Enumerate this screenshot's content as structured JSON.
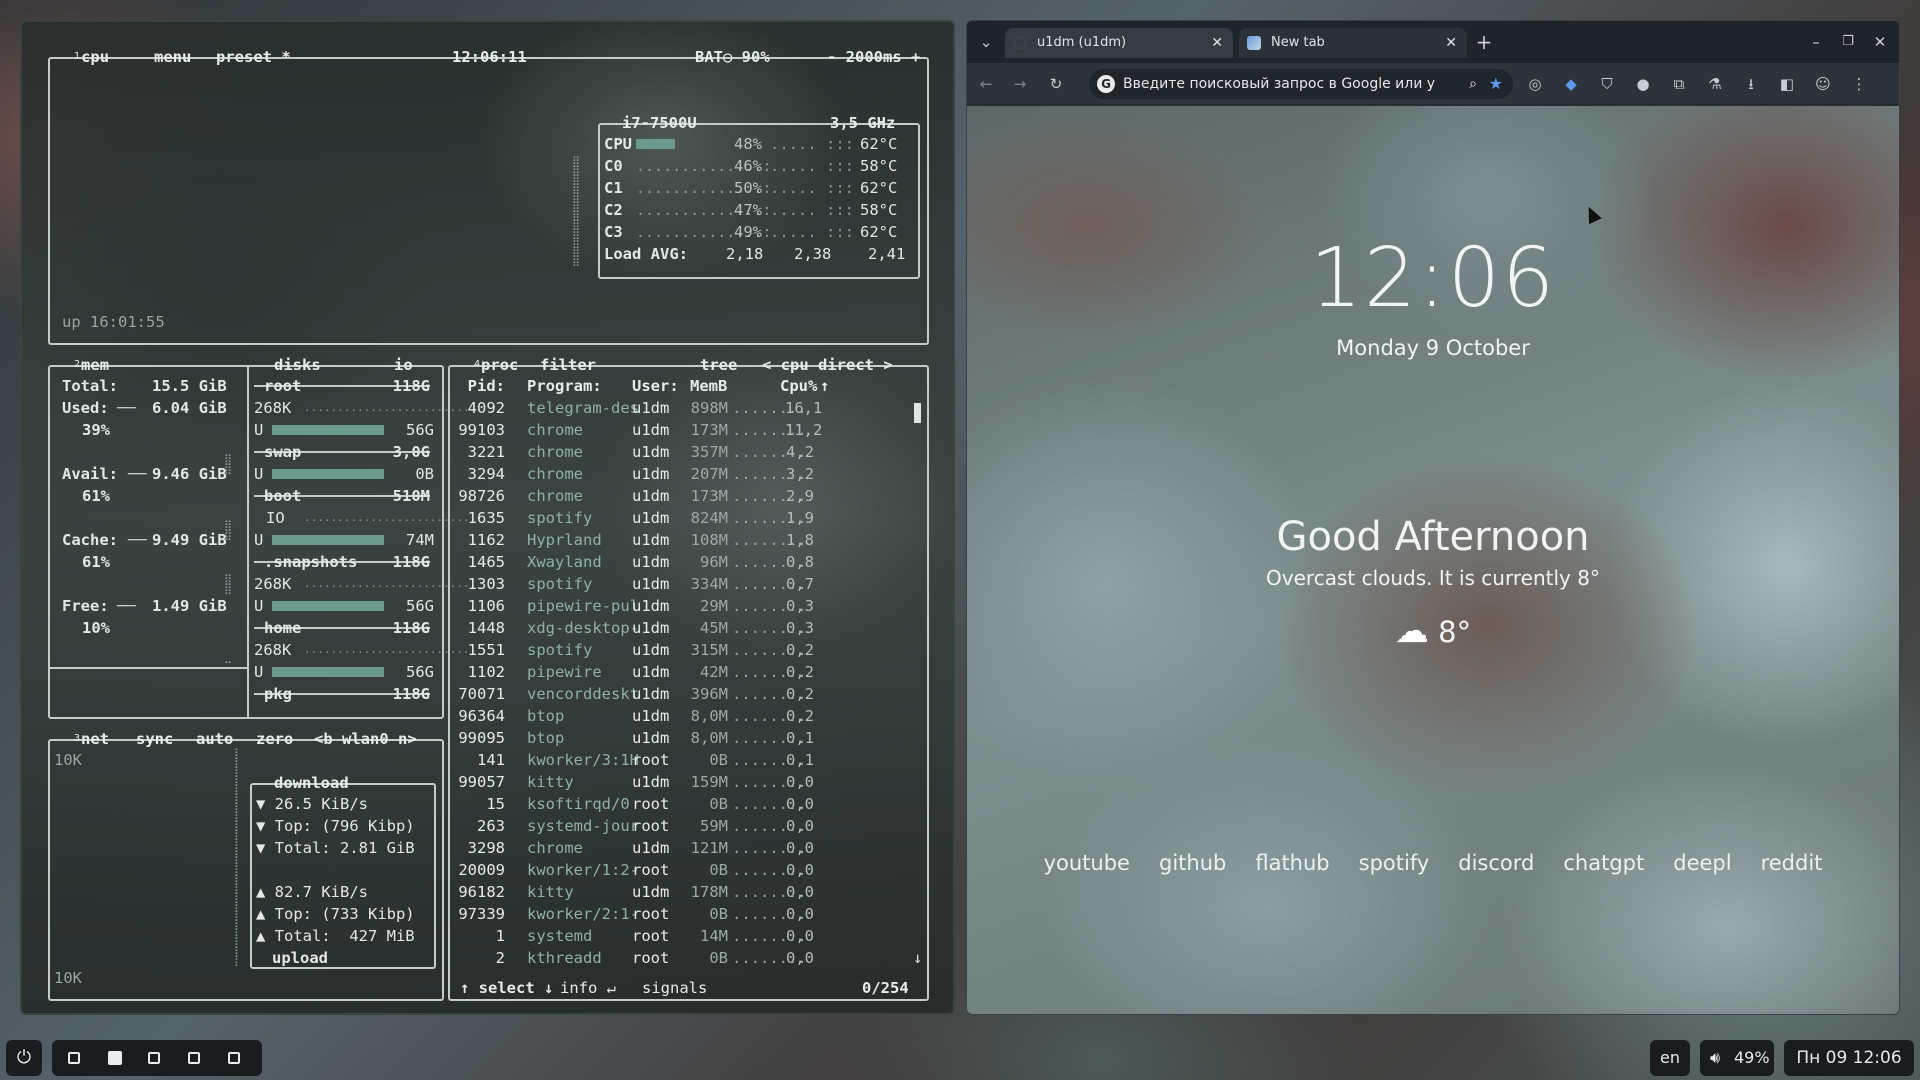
{
  "terminal": {
    "cpu_box": {
      "num": "1",
      "title": "cpu",
      "menu": "menu",
      "preset": "preset *",
      "clock": "12:06:11",
      "battery": "BAT○ 90%",
      "interval": "- 2000ms +",
      "uptime": "up 16:01:55",
      "cpu_model": "i7-7500U",
      "freq": "3,5 GHz",
      "rows": [
        {
          "label": "CPU",
          "pct": "48%",
          "pct_value": 48,
          "temp": "62°C"
        },
        {
          "label": "C0",
          "pct": "46%",
          "pct_value": 46,
          "temp": "58°C"
        },
        {
          "label": "C1",
          "pct": "50%",
          "pct_value": 50,
          "temp": "62°C"
        },
        {
          "label": "C2",
          "pct": "47%",
          "pct_value": 47,
          "temp": "58°C"
        },
        {
          "label": "C3",
          "pct": "49%",
          "pct_value": 49,
          "temp": "62°C"
        }
      ],
      "load_label": "Load AVG:",
      "load_values": [
        "2,18",
        "2,38",
        "2,41"
      ]
    },
    "mem_box": {
      "num": "2",
      "title": "mem",
      "total_label": "Total:",
      "total": "15.5 GiB",
      "used_label": "Used:",
      "used": "6.04 GiB",
      "used_pct": "39%",
      "avail_label": "Avail:",
      "avail": "9.46 GiB",
      "avail_pct": "61%",
      "cache_label": "Cache:",
      "cache": "9.49 GiB",
      "cache_pct": "61%",
      "free_label": "Free:",
      "free": "1.49 GiB",
      "free_pct": "10%"
    },
    "disks_box": {
      "title": "disks",
      "io": "io",
      "root_name": "root",
      "root_size": "118G",
      "root_io": "268K",
      "root_used": "56G",
      "swap_name": "swap",
      "swap_size": "3,0G",
      "swap_used": "0B",
      "boot_name": "boot",
      "boot_size": "510M",
      "boot_io_label": "IO",
      "boot_used": "74M",
      "snap_name": ".snapshots",
      "snap_size": "118G",
      "snap_io": "268K",
      "snap_used": "56G",
      "home_name": "home",
      "home_size": "118G",
      "home_io": "268K",
      "home_used": "56G",
      "pkg_name": "pkg",
      "pkg_size": "118G",
      "u_label": "U"
    },
    "net_box": {
      "num": "3",
      "title": "net",
      "sync": "sync",
      "auto": "auto",
      "zero": "zero",
      "iface_nav": "<b wlan0 n>",
      "scale_top": "10K",
      "scale_bottom": "10K",
      "download_title": "download",
      "dl_rate": "▼ 26.5 KiB/s",
      "dl_top": "▼ Top: (796 Kibp)",
      "dl_total": "▼ Total: 2.81 GiB",
      "ul_rate": "▲ 82.7 KiB/s",
      "ul_top": "▲ Top: (733 Kibp)",
      "ul_total": "▲ Total:  427 MiB",
      "upload_title": "upload"
    },
    "proc_box": {
      "num": "4",
      "title": "proc",
      "filter": "filter",
      "tree": "tree",
      "sort": "< cpu direct >",
      "headers": {
        "pid": "Pid:",
        "program": "Program:",
        "user": "User:",
        "mem": "MemB",
        "cpu": "Cpu%"
      },
      "rows": [
        {
          "pid": "4092",
          "program": "telegram-des",
          "user": "u1dm",
          "mem": "898M",
          "cpu": "16,1"
        },
        {
          "pid": "99103",
          "program": "chrome",
          "user": "u1dm",
          "mem": "173M",
          "cpu": "11,2"
        },
        {
          "pid": "3221",
          "program": "chrome",
          "user": "u1dm",
          "mem": "357M",
          "cpu": "4,2"
        },
        {
          "pid": "3294",
          "program": "chrome",
          "user": "u1dm",
          "mem": "207M",
          "cpu": "3,2"
        },
        {
          "pid": "98726",
          "program": "chrome",
          "user": "u1dm",
          "mem": "173M",
          "cpu": "2,9"
        },
        {
          "pid": "1635",
          "program": "spotify",
          "user": "u1dm",
          "mem": "824M",
          "cpu": "1,9"
        },
        {
          "pid": "1162",
          "program": "Hyprland",
          "user": "u1dm",
          "mem": "108M",
          "cpu": "1,8"
        },
        {
          "pid": "1465",
          "program": "Xwayland",
          "user": "u1dm",
          "mem": "96M",
          "cpu": "0,8"
        },
        {
          "pid": "1303",
          "program": "spotify",
          "user": "u1dm",
          "mem": "334M",
          "cpu": "0,7"
        },
        {
          "pid": "1106",
          "program": "pipewire-pul",
          "user": "u1dm",
          "mem": "29M",
          "cpu": "0,3"
        },
        {
          "pid": "1448",
          "program": "xdg-desktop-",
          "user": "u1dm",
          "mem": "45M",
          "cpu": "0,3"
        },
        {
          "pid": "1551",
          "program": "spotify",
          "user": "u1dm",
          "mem": "315M",
          "cpu": "0,2"
        },
        {
          "pid": "1102",
          "program": "pipewire",
          "user": "u1dm",
          "mem": "42M",
          "cpu": "0,2"
        },
        {
          "pid": "70071",
          "program": "vencorddeskt",
          "user": "u1dm",
          "mem": "396M",
          "cpu": "0,2"
        },
        {
          "pid": "96364",
          "program": "btop",
          "user": "u1dm",
          "mem": "8,0M",
          "cpu": "0,2"
        },
        {
          "pid": "99095",
          "program": "btop",
          "user": "u1dm",
          "mem": "8,0M",
          "cpu": "0,1"
        },
        {
          "pid": "141",
          "program": "kworker/3:1H",
          "user": "root",
          "mem": "0B",
          "cpu": "0,1"
        },
        {
          "pid": "99057",
          "program": "kitty",
          "user": "u1dm",
          "mem": "159M",
          "cpu": "0,0"
        },
        {
          "pid": "15",
          "program": "ksoftirqd/0",
          "user": "root",
          "mem": "0B",
          "cpu": "0,0"
        },
        {
          "pid": "263",
          "program": "systemd-jour",
          "user": "root",
          "mem": "59M",
          "cpu": "0,0"
        },
        {
          "pid": "3298",
          "program": "chrome",
          "user": "u1dm",
          "mem": "121M",
          "cpu": "0,0"
        },
        {
          "pid": "20009",
          "program": "kworker/1:2-",
          "user": "root",
          "mem": "0B",
          "cpu": "0,0"
        },
        {
          "pid": "96182",
          "program": "kitty",
          "user": "u1dm",
          "mem": "178M",
          "cpu": "0,0"
        },
        {
          "pid": "97339",
          "program": "kworker/2:1-",
          "user": "root",
          "mem": "0B",
          "cpu": "0,0"
        },
        {
          "pid": "1",
          "program": "systemd",
          "user": "root",
          "mem": "14M",
          "cpu": "0,0"
        },
        {
          "pid": "2",
          "program": "kthreadd",
          "user": "root",
          "mem": "0B",
          "cpu": "0,0"
        }
      ],
      "footer_select": "↑ select ↓",
      "footer_info": "info ↵",
      "footer_signals": "signals",
      "footer_count": "0/254"
    }
  },
  "browser": {
    "tabs": [
      {
        "label": "u1dm (u1dm)",
        "active": false
      },
      {
        "label": "New tab",
        "active": true
      }
    ],
    "omnibox_placeholder": "Введите поисковый запрос в Google или у",
    "ntp": {
      "time": "12:06",
      "date": "Monday 9 October",
      "greeting": "Good Afternoon",
      "weather_text": "Overcast clouds. It is currently 8°",
      "temp": "8°",
      "shortcuts": [
        "youtube",
        "github",
        "flathub",
        "spotify",
        "discord",
        "chatgpt",
        "deepl",
        "reddit"
      ]
    }
  },
  "taskbar": {
    "workspaces": [
      "1",
      "2",
      "3",
      "4",
      "5"
    ],
    "active_workspace": 2,
    "lang": "en",
    "volume": "49%",
    "datetime": "Пн 09 12:06"
  },
  "colors": {
    "meter": "#6c9a8e",
    "process_name": "#8fb1a8",
    "border": "#c4ccca",
    "taskbar_bg": "#1a1c1e"
  }
}
